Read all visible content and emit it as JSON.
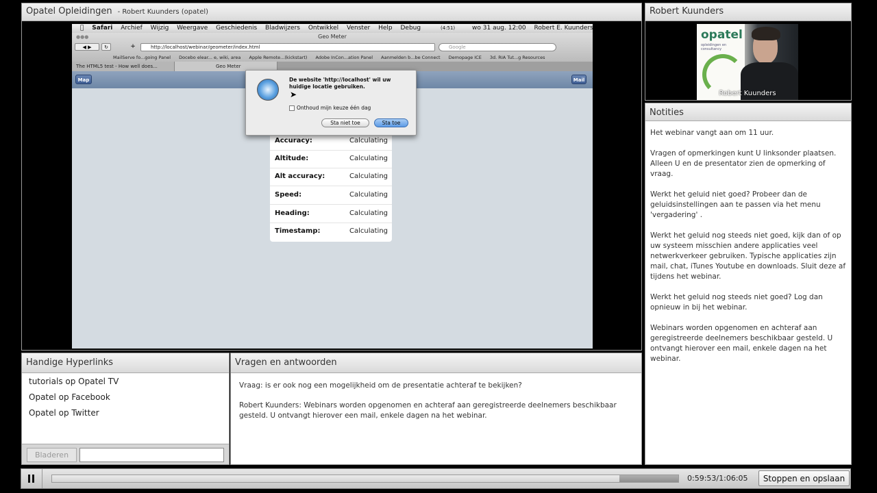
{
  "share_pod": {
    "title": "Opatel Opleidingen",
    "subtitle": "- Robert Kuunders (opatel)"
  },
  "mac": {
    "menubar": [
      "Safari",
      "Archief",
      "Wijzig",
      "Weergave",
      "Geschiedenis",
      "Bladwijzers",
      "Ontwikkel",
      "Venster",
      "Help",
      "Debug"
    ],
    "clock": "wo 31 aug.  12:00",
    "user": "Robert E. Kuunders",
    "battery": "(4:51)",
    "window_title": "Geo Meter",
    "url": "http://localhost/webinar/geometer/index.html",
    "search_placeholder": "Google",
    "bookmarks": [
      "MailServe fo...going Panel",
      "Docebo elear... e, wiki, area",
      "Apple Remote...(kickstart)",
      "Adobe InCon...ation Panel",
      "Aanmelden b...be Connect",
      "Demopage ICE",
      "3d. RIA Tut...g Resources"
    ],
    "tabs": [
      "The HTML5 test - How well does...",
      "Geo Meter"
    ],
    "ios_left_btn": "Map",
    "ios_right_btn": "Mail",
    "geo_rows": [
      {
        "label": "Accuracy:",
        "value": "Calculating"
      },
      {
        "label": "Altitude:",
        "value": "Calculating"
      },
      {
        "label": "Alt accuracy:",
        "value": "Calculating"
      },
      {
        "label": "Speed:",
        "value": "Calculating"
      },
      {
        "label": "Heading:",
        "value": "Calculating"
      },
      {
        "label": "Timestamp:",
        "value": "Calculating"
      }
    ],
    "dialog": {
      "message": "De website 'http://localhost' wil uw huidige locatie gebruiken.",
      "checkbox": "Onthoud mijn keuze één dag",
      "deny": "Sta niet toe",
      "allow": "Sta toe"
    }
  },
  "camera_pod": {
    "title": "Robert Kuunders",
    "name_overlay": "Robert Kuunders",
    "logo_text": "opatel",
    "logo_sub": "opleidingen en consultancy"
  },
  "notes_pod": {
    "title": "Notities",
    "paragraphs": [
      "Het webinar vangt aan om 11 uur.",
      "Vragen of opmerkingen kunt U linksonder plaatsen. Alleen U en de presentator zien de opmerking of vraag.",
      "Werkt het geluid niet goed? Probeer dan de geluidsinstellingen aan te passen via het menu 'vergadering' .",
      "Werkt het geluid nog steeds niet goed, kijk dan of op uw systeem misschien andere applicaties veel netwerkverkeer gebruiken. Typische applicaties zijn mail, chat, iTunes Youtube en downloads. Sluit deze af tijdens het webinar.",
      "Werkt het geluid nog steeds niet goed? Log dan opnieuw in bij het webinar.",
      "Webinars worden opgenomen en achteraf aan geregistreerde deelnemers beschikbaar gesteld. U ontvangt hierover een mail, enkele dagen na het webinar."
    ]
  },
  "links_pod": {
    "title": "Handige Hyperlinks",
    "links": [
      "tutorials op Opatel TV",
      "Opatel op Facebook",
      "Opatel op Twitter"
    ],
    "browse_button": "Bladeren",
    "input_value": ""
  },
  "qa_pod": {
    "title": "Vragen en antwoorden",
    "question": "Vraag: is er ook nog een mogelijkheid om de presentatie achteraf te bekijken?",
    "answer": "Robert Kuunders: Webinars worden opgenomen en achteraf aan geregistreerde deelnemers beschikbaar gesteld. U ontvangt hierover een mail, enkele dagen na het webinar."
  },
  "playback": {
    "time": "0:59:53/1:06:05",
    "progress_fraction": 0.906,
    "stop_button": "Stoppen en opslaan"
  },
  "colors": {
    "pod_border": "#9a9a9a",
    "ios_blue": "#6e87a6",
    "allow_blue": "#5d9be6"
  }
}
